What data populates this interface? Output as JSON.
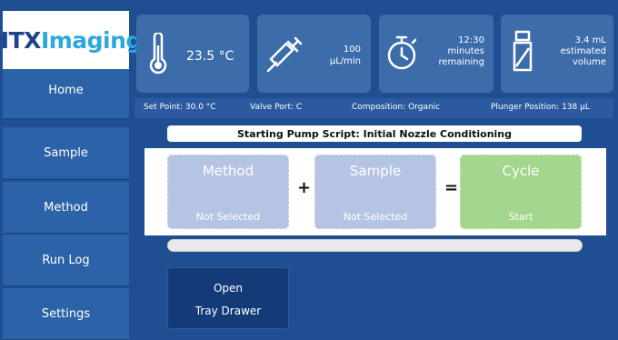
{
  "logo": {
    "part1": "HTX",
    "part2": "Imaging"
  },
  "nav": [
    "Home",
    "Sample",
    "Method",
    "Run Log",
    "Settings"
  ],
  "cards": {
    "temperature": {
      "value": "23.5 °C",
      "icon": "thermometer-icon"
    },
    "flow": {
      "line1": "100",
      "line2": "µL/min",
      "icon": "syringe-icon"
    },
    "timer": {
      "line1": "12:30",
      "line2": "minutes",
      "line3": "remaining",
      "icon": "stopwatch-icon"
    },
    "volume": {
      "line1": "3.4 mL",
      "line2": "estimated",
      "line3": "volume",
      "icon": "vial-icon"
    }
  },
  "info": {
    "set_point": "Set Point: 30.0 °C",
    "valve_port": "Valve Port: C",
    "composition": "Composition: Organic",
    "plunger": "Plunger Position: 138 µL"
  },
  "script_title": "Starting Pump Script: Initial Nozzle Conditioning",
  "flow": {
    "method": {
      "title": "Method",
      "status": "Not Selected"
    },
    "plus": "+",
    "sample": {
      "title": "Sample",
      "status": "Not Selected"
    },
    "equals": "=",
    "cycle": {
      "title": "Cycle",
      "status": "Start"
    }
  },
  "progress": {
    "fraction": 0
  },
  "tray": {
    "line1": "Open",
    "line2": "Tray Drawer"
  },
  "colors": {
    "background": "#1f4e93",
    "accent": "#2aa8df",
    "start_green": "#a4d68e",
    "disabled": "#b6c4e3"
  }
}
